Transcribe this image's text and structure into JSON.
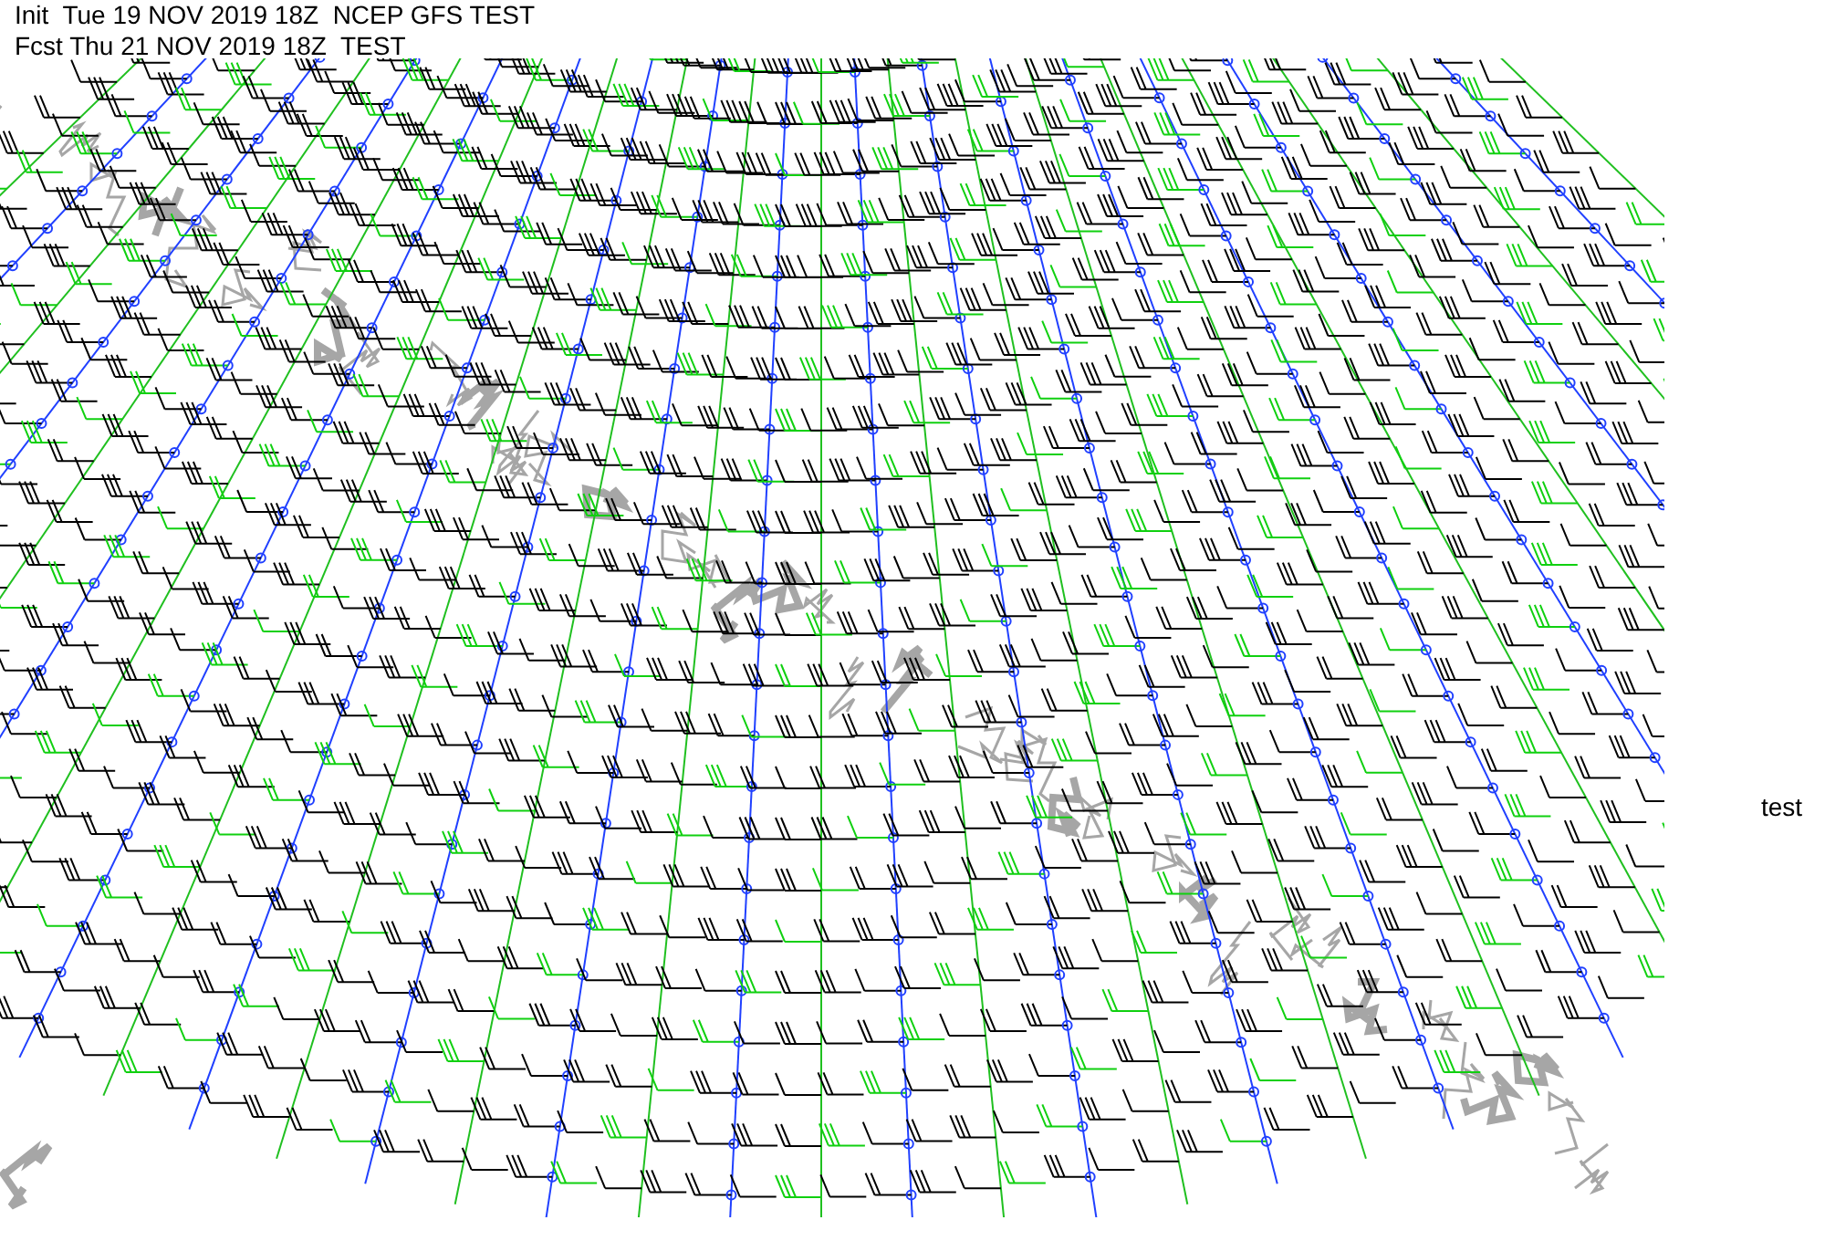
{
  "header": {
    "lines": [
      "Init  Tue 19 NOV 2019 18Z  NCEP GFS TEST",
      "Fcst Thu 21 NOV 2019 18Z  TEST"
    ]
  },
  "side_label": "test"
}
